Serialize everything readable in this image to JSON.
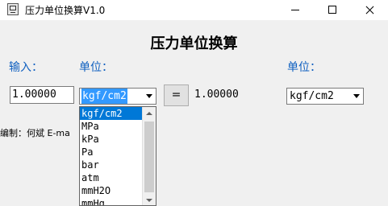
{
  "window": {
    "title": "压力单位换算V1.0",
    "controls": [
      "minimize-icon",
      "maximize-icon",
      "close-icon"
    ]
  },
  "heading": "压力单位换算",
  "labels": {
    "input": "输入：",
    "unit_from": "单位：",
    "unit_to": "单位："
  },
  "input_value": "1.00000",
  "from_unit": {
    "selected": "kgf/cm2"
  },
  "convert_button": "=",
  "result_value": "1.00000",
  "to_unit": {
    "selected": "kgf/cm2"
  },
  "footer": "编制：何斌  E-ma",
  "dropdown": {
    "items": [
      "kgf/cm2",
      "MPa",
      "kPa",
      "Pa",
      "bar",
      "atm",
      "mmH2O",
      "mmHg"
    ],
    "selected_index": 0
  },
  "colors": {
    "label_blue": "#1060c0",
    "selection": "#0078d7"
  }
}
